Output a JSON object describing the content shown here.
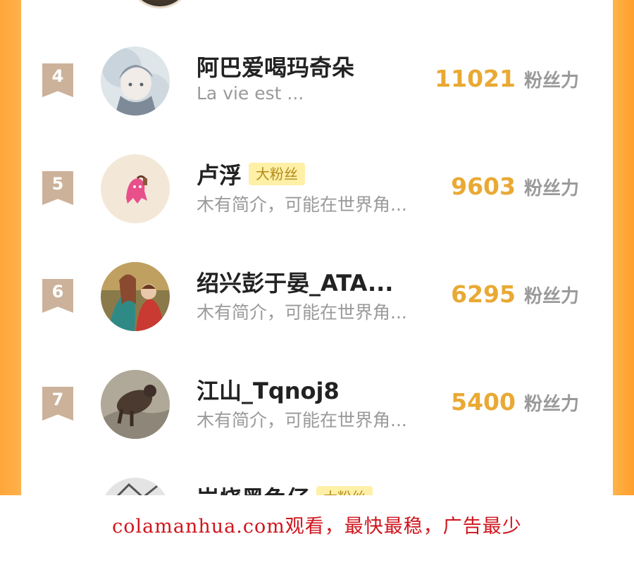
{
  "ranking": {
    "items": [
      {
        "rank": "4",
        "name": "阿巴爱喝玛奇朵",
        "bio": "La vie est ...",
        "badge": "",
        "score": "11021",
        "score_unit": "粉丝力"
      },
      {
        "rank": "5",
        "name": "卢浮",
        "bio": "木有简介，可能在世界角...",
        "badge": "大粉丝",
        "score": "9603",
        "score_unit": "粉丝力"
      },
      {
        "rank": "6",
        "name": "绍兴彭于晏_ATA...",
        "bio": "木有简介，可能在世界角...",
        "badge": "",
        "score": "6295",
        "score_unit": "粉丝力"
      },
      {
        "rank": "7",
        "name": "江山_Tqnoj8",
        "bio": "木有简介，可能在世界角...",
        "badge": "",
        "score": "5400",
        "score_unit": "粉丝力"
      },
      {
        "rank": "",
        "name": "岩烧黑兔仔",
        "bio": "",
        "badge": "大粉丝",
        "score": "",
        "score_unit": ""
      }
    ]
  },
  "footer": {
    "text": "colamanhua.com观看，最快最稳，广告最少"
  },
  "colors": {
    "accent_orange": "#ffb246",
    "score_gold": "#e9a934",
    "rank_badge": "#ccb29a",
    "fan_badge_bg": "#fff0a8",
    "footer_red": "#d0141c"
  }
}
